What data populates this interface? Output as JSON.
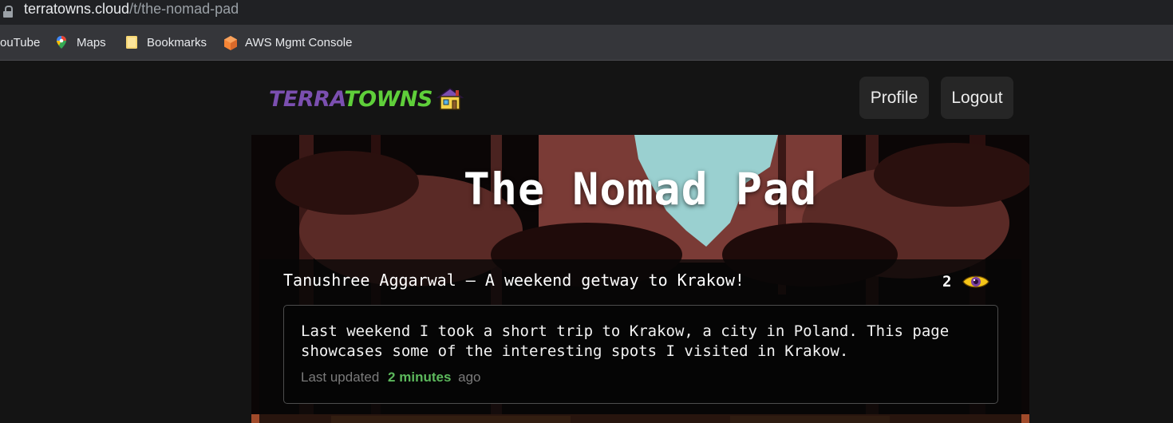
{
  "browser": {
    "url_host": "terratowns.cloud",
    "url_path": "/t/the-nomad-pad",
    "bookmarks": [
      {
        "label": "ouTube",
        "icon": "youtube-icon"
      },
      {
        "label": "Maps",
        "icon": "maps-pin-icon"
      },
      {
        "label": "Bookmarks",
        "icon": "folder-icon"
      },
      {
        "label": "AWS Mgmt Console",
        "icon": "aws-cube-icon"
      }
    ]
  },
  "header": {
    "logo_terra": "TERRA",
    "logo_towns": "TOWNS",
    "logo_icon": "house-icon",
    "profile_label": "Profile",
    "logout_label": "Logout"
  },
  "town": {
    "title": "The Nomad Pad",
    "post": {
      "title": "Tanushree Aggarwal — A weekend getway to Krakow!",
      "views": "2",
      "description": "Last weekend I took a short trip to Krakow, a city in Poland. This page showcases some of the interesting spots I visited in Krakow.",
      "updated_prefix": "Last updated",
      "updated_value": "2 minutes",
      "updated_suffix": "ago"
    }
  },
  "colors": {
    "accent_green": "#5cb85c",
    "logo_purple": "#7b4fb0",
    "logo_green": "#5fcf3a",
    "eye_yellow": "#f5c518"
  }
}
